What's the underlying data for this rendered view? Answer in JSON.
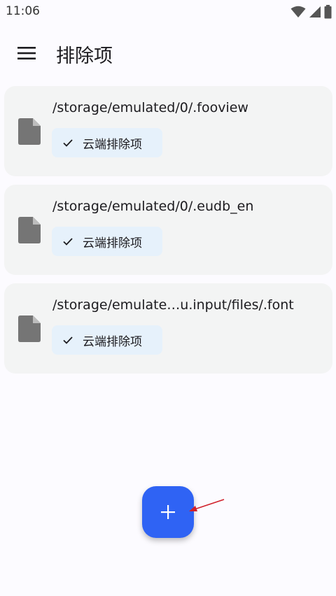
{
  "status_bar": {
    "time": "11:06",
    "icons": [
      "wifi-icon",
      "signal-icon",
      "battery-icon"
    ]
  },
  "app_bar": {
    "title": "排除项",
    "menu_icon": "menu-icon"
  },
  "exclusions": [
    {
      "path": "/storage/emulated/0/.fooview",
      "tag": "云端排除项",
      "icon": "file-icon"
    },
    {
      "path": "/storage/emulated/0/.eudb_en",
      "tag": "云端排除项",
      "icon": "file-icon"
    },
    {
      "path": "/storage/emulate…u.input/files/.font",
      "tag": "云端排除项",
      "icon": "file-icon"
    }
  ],
  "fab": {
    "icon": "plus-icon"
  },
  "colors": {
    "accent": "#2f63f4",
    "card_bg": "#f3f4f4",
    "chip_bg": "#e6f1fb",
    "annotation_arrow": "#d0202a"
  }
}
